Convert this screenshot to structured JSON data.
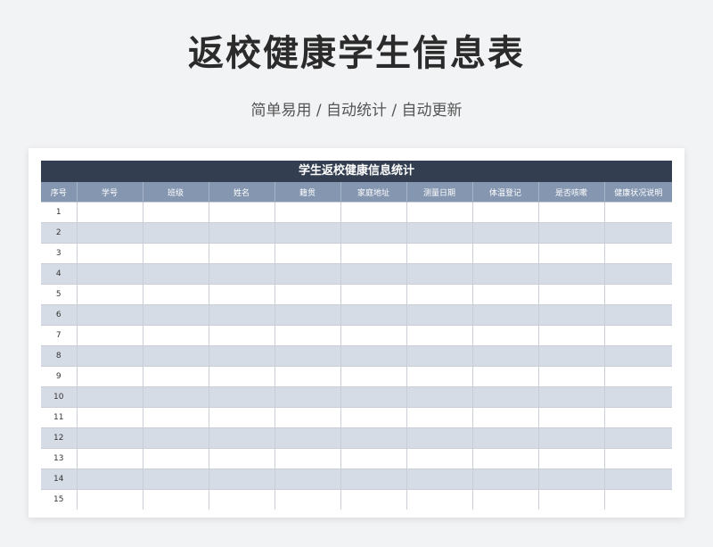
{
  "page": {
    "title": "返校健康学生信息表",
    "subtitle": "简单易用 / 自动统计 / 自动更新"
  },
  "table": {
    "banner": "学生返校健康信息统计",
    "headers": [
      "序号",
      "学号",
      "班级",
      "姓名",
      "籍贯",
      "家庭地址",
      "测量日期",
      "体温登记",
      "是否咳嗽",
      "健康状况说明"
    ],
    "row_numbers": [
      "1",
      "2",
      "3",
      "4",
      "5",
      "6",
      "7",
      "8",
      "9",
      "10",
      "11",
      "12",
      "13",
      "14",
      "15"
    ]
  },
  "colors": {
    "banner_bg": "#333f50",
    "header_bg": "#8496b0",
    "stripe": "#d6dce5",
    "page_bg": "#f2f3f5"
  }
}
